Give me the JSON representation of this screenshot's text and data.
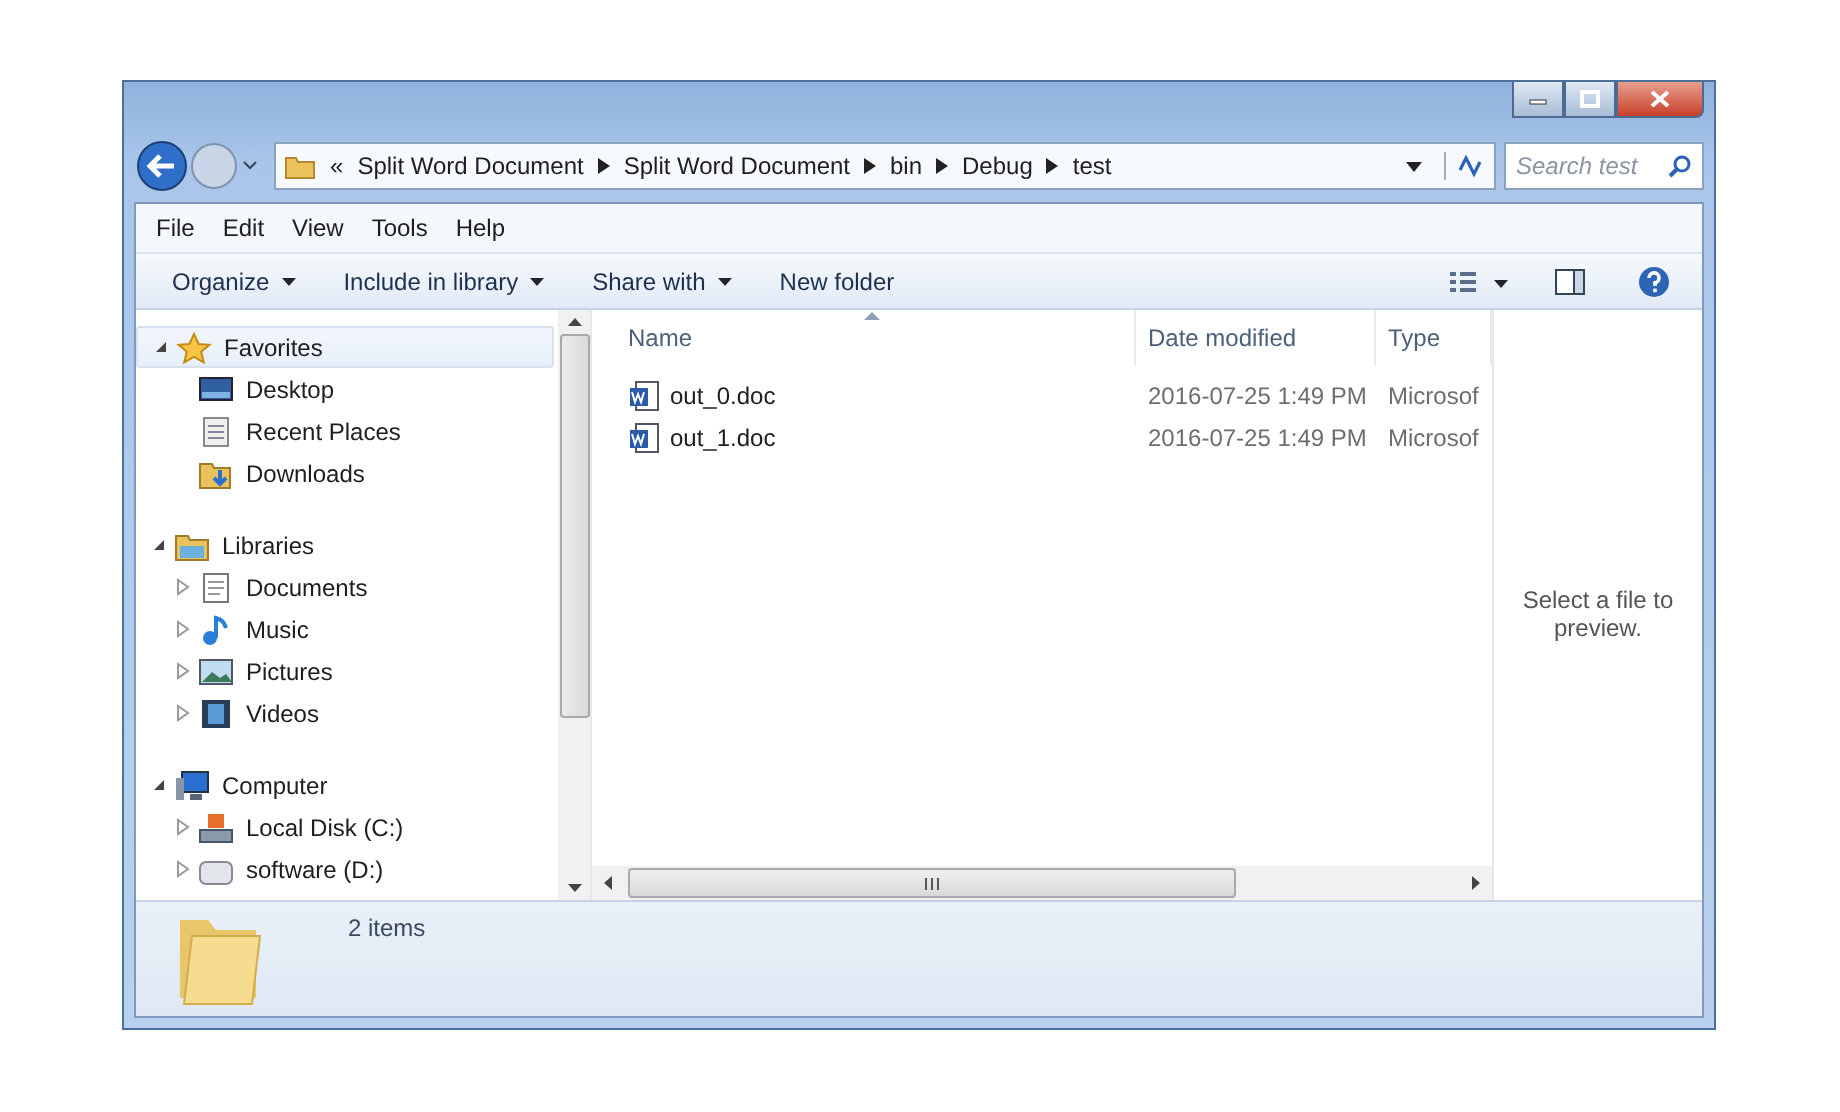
{
  "address": {
    "overflow": "«",
    "path": [
      "Split Word Document",
      "Split Word Document",
      "bin",
      "Debug",
      "test"
    ]
  },
  "search": {
    "placeholder": "Search test"
  },
  "menu": [
    "File",
    "Edit",
    "View",
    "Tools",
    "Help"
  ],
  "toolbar": [
    {
      "label": "Organize",
      "dropdown": true
    },
    {
      "label": "Include in library",
      "dropdown": true
    },
    {
      "label": "Share with",
      "dropdown": true
    },
    {
      "label": "New folder",
      "dropdown": false
    }
  ],
  "nav": [
    {
      "label": "Favorites",
      "kind": "star",
      "expanded": true,
      "selected": true,
      "children": [
        {
          "label": "Desktop",
          "kind": "desktop",
          "expandable": false,
          "selected": false
        },
        {
          "label": "Recent Places",
          "kind": "recent",
          "expandable": false,
          "selected": false
        },
        {
          "label": "Downloads",
          "kind": "downloads",
          "expandable": false,
          "selected": false
        }
      ]
    },
    {
      "label": "Libraries",
      "kind": "library",
      "expanded": true,
      "selected": false,
      "children": [
        {
          "label": "Documents",
          "kind": "documents",
          "expandable": true,
          "selected": false
        },
        {
          "label": "Music",
          "kind": "music",
          "expandable": true,
          "selected": false
        },
        {
          "label": "Pictures",
          "kind": "pictures",
          "expandable": true,
          "selected": false
        },
        {
          "label": "Videos",
          "kind": "videos",
          "expandable": true,
          "selected": false
        }
      ]
    },
    {
      "label": "Computer",
      "kind": "computer",
      "expanded": true,
      "selected": false,
      "children": [
        {
          "label": "Local Disk (C:)",
          "kind": "disk",
          "expandable": true,
          "selected": false
        },
        {
          "label": "software (D:)",
          "kind": "drive",
          "expandable": true,
          "selected": false
        }
      ]
    }
  ],
  "table": {
    "columns": [
      {
        "label": "Name",
        "sorted": true
      },
      {
        "label": "Date modified",
        "sorted": false
      },
      {
        "label": "Type",
        "sorted": false
      }
    ],
    "rows": [
      {
        "name": "out_0.doc",
        "date": "2016-07-25 1:49 PM",
        "type": "Microsof",
        "selected": false
      },
      {
        "name": "out_1.doc",
        "date": "2016-07-25 1:49 PM",
        "type": "Microsof",
        "selected": false
      }
    ]
  },
  "preview": {
    "message": "Select a file to preview."
  },
  "status_bar": {
    "count": "2 items"
  }
}
